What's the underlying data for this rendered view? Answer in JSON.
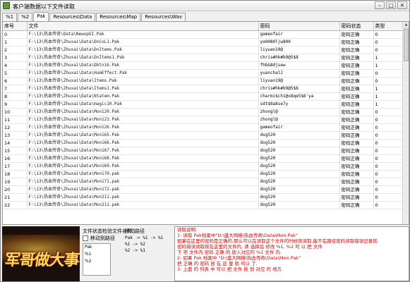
{
  "window": {
    "title": "客户端数据以下文件读取",
    "caption": {
      "minimize": "–",
      "maximize": "□",
      "close": "✕"
    }
  },
  "tabs": [
    {
      "label": "%1",
      "active": false
    },
    {
      "label": "%2",
      "active": false
    },
    {
      "label": "Pak",
      "active": true
    },
    {
      "label": "Resources\\Data",
      "active": false
    },
    {
      "label": "Resources\\Map",
      "active": false
    },
    {
      "label": "Resources\\Wav",
      "active": false
    }
  ],
  "table": {
    "headers": [
      "序号",
      "文件",
      "密码",
      "密码状态",
      "类型"
    ],
    "rows": [
      [
        "0",
        "F:\\13\\热血传奇\\Data\\NewopUI.Pak",
        "gameofair",
        "密码正确",
        "0"
      ],
      [
        "1",
        "F:\\13\\热血传奇\\Zhuxai\\Data\\DnCoL1.Pak",
        "ya9080ljw800",
        "密码正确",
        "0"
      ],
      [
        "2",
        "F:\\13\\热血传奇\\Zhuxai\\Data\\DnItems.Pak",
        "liyuan19@",
        "密码正确",
        "0"
      ],
      [
        "3",
        "F:\\13\\热血传奇\\Zhuxai\\Data\\DnItems1.Pak",
        "chris#hk#b9@5$8",
        "密码正确",
        "1"
      ],
      [
        "4",
        "F:\\13\\热血传奇\\Zhuxai\\Data\\Dbtn16.Pak",
        "fhb&8djsew",
        "密码正确",
        "1"
      ],
      [
        "5",
        "F:\\13\\热血传奇\\Zhuxai\\Data\\HumEffect.Pak",
        "yuanchal2",
        "密码正确",
        "0"
      ],
      [
        "6",
        "F:\\13\\热血传奇\\Zhuxai\\Data\\Items.Pak",
        "liyuan19@",
        "密码正确",
        "0"
      ],
      [
        "7",
        "F:\\13\\热血传奇\\Zhuxai\\Data\\Items1.Pak",
        "chris#hk#b9@5$8",
        "密码正确",
        "1"
      ],
      [
        "8",
        "F:\\13\\热血传奇\\Zhuxai\\Data\\Ntatem.Pak",
        "charmi$ch1@x8qe5$8'ya",
        "密码正确",
        "1"
      ],
      [
        "9",
        "F:\\13\\热血传奇\\Zhuxai\\Data\\magic10.Pak",
        "sdt$8a8se7y",
        "密码正确",
        "1"
      ],
      [
        "10",
        "F:\\13\\热血传奇\\Zhuxai\\Data\\Mon120.Pak",
        "zhongl@",
        "密码正确",
        "0"
      ],
      [
        "11",
        "F:\\13\\热血传奇\\Zhuxai\\Data\\Mon123.Pak",
        "zhongl@",
        "密码正确",
        "0"
      ],
      [
        "12",
        "F:\\13\\热血传奇\\Zhuxai\\Data\\Mon126.Pak",
        "gameofair",
        "密码正确",
        "0"
      ],
      [
        "13",
        "F:\\13\\热血传奇\\Zhuxai\\Data\\Mon165.Pak",
        "dxg520",
        "密码正确",
        "0"
      ],
      [
        "14",
        "F:\\13\\热血传奇\\Zhuxai\\Data\\Mon166.Pak",
        "dxg520",
        "密码正确",
        "0"
      ],
      [
        "15",
        "F:\\13\\热血传奇\\Zhuxai\\Data\\Mon167.Pak",
        "dxg520",
        "密码正确",
        "0"
      ],
      [
        "16",
        "F:\\13\\热血传奇\\Zhuxai\\Data\\Mon168.Pak",
        "dxg520",
        "密码正确",
        "0"
      ],
      [
        "17",
        "F:\\13\\热血传奇\\Zhuxai\\Data\\Mon169.Pak",
        "dxg520",
        "密码正确",
        "0"
      ],
      [
        "18",
        "F:\\13\\热血传奇\\Zhuxai\\Data\\Mon170.pak",
        "dxg520",
        "密码正确",
        "0"
      ],
      [
        "19",
        "F:\\13\\热血传奇\\Zhuxai\\Data\\Mon171.pak",
        "dxg520",
        "密码正确",
        "0"
      ],
      [
        "20",
        "F:\\13\\热血传奇\\Zhuxai\\Data\\Mon172.pak",
        "dxg520",
        "密码正确",
        "0"
      ],
      [
        "21",
        "F:\\13\\热血传奇\\Zhuxai\\Data\\Mon211.pak",
        "dxg520",
        "密码正确",
        "0"
      ],
      [
        "22",
        "F:\\13\\热血传奇\\Zhuxai\\Data\\Mon212.pak",
        "dxg520",
        "密码正确",
        "0"
      ]
    ]
  },
  "bottom": {
    "logo_text": "军哥做大事",
    "ctrl_label": "文件状态检验文件名称",
    "checkbox_label": "移动到路径",
    "path_lines": [
      "Pak",
      "%1",
      "%2"
    ],
    "move_label": "移动路径",
    "move_items": [
      "Pak -> %1 -> %1",
      "%1 -> %2",
      "%2 -> %1"
    ],
    "instructions": [
      "读取说明:",
      "1: 读取 Pak档案中\"D:\\盛大网络\\热血传奇\\Data\\Mon.Pak\"",
      "   如果在这里的密码是正确的,那么可以在读取这个文件的时候就读取,能不在路径密码读取错误记录就.",
      "   密码错误读取就在这里的文件内, 请 选择后 修改 %1, %2 可 以 把 文件",
      "   下 项 文件内 密码 正确 的 放入对应的 %1 文件 内.",
      "2: 如果 Pak 档案中 \"D:\\盛大网络\\热血传奇\\Data\\Mon.Pak\"",
      "   把 正确 的 密码 放 在 这 里 就 可以 了.",
      "3: 上面 的 列表 中 可以 把 文件 拖 到 对应 的 地方."
    ]
  },
  "colors": {
    "instruction_text": "#d00000",
    "logo_text": "#ffd75a"
  }
}
